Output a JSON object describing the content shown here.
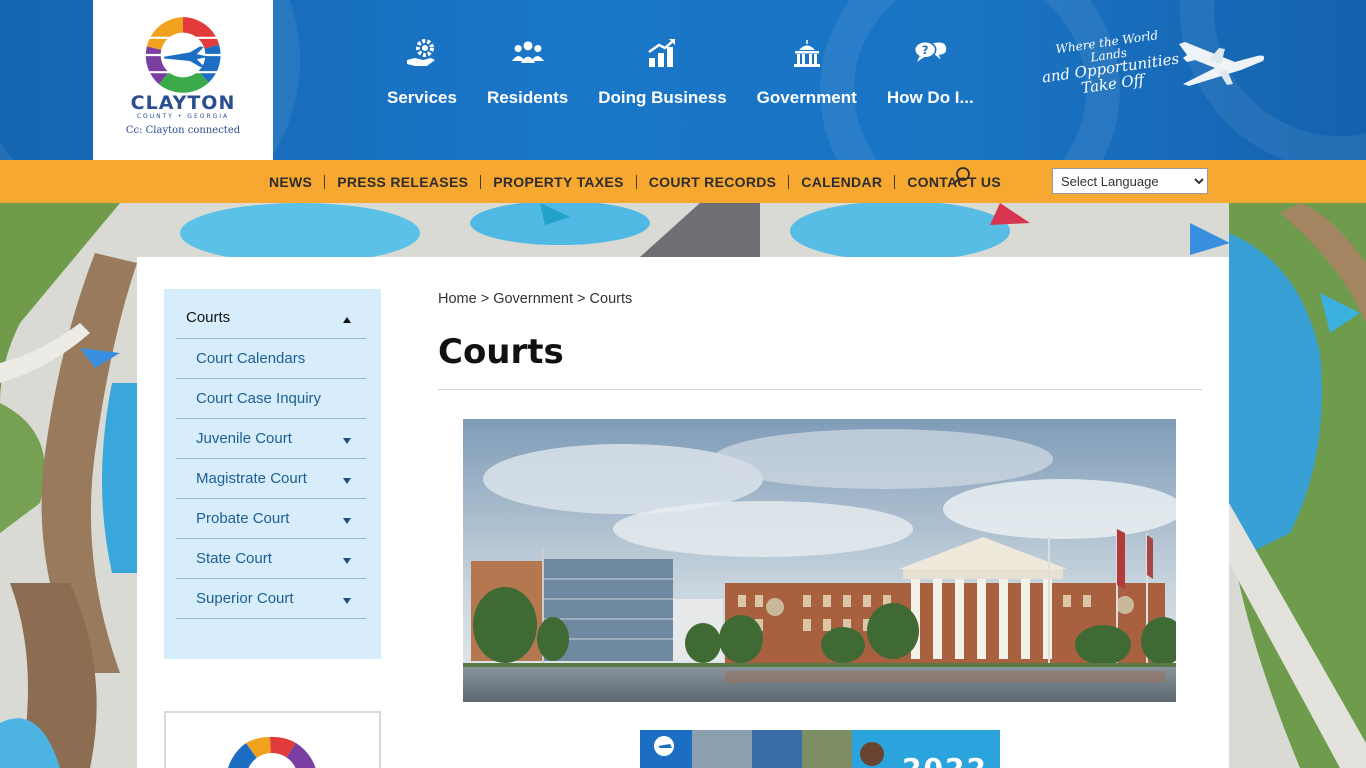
{
  "header": {
    "logo": {
      "name": "CLAYTON",
      "sub": "COUNTY • GEORGIA",
      "tagline": "Cc: Clayton connected"
    },
    "nav": [
      {
        "label": "Services",
        "icon": "hand-gear-icon"
      },
      {
        "label": "Residents",
        "icon": "people-icon"
      },
      {
        "label": "Doing Business",
        "icon": "bar-chart-icon"
      },
      {
        "label": "Government",
        "icon": "capitol-building-icon"
      },
      {
        "label": "How Do I...",
        "icon": "question-chat-icon"
      }
    ],
    "slogan": {
      "line1": "Where the World Lands",
      "line2": "and Opportunities",
      "line3": "Take Off"
    }
  },
  "utility": {
    "links": [
      "NEWS",
      "PRESS RELEASES",
      "PROPERTY TAXES",
      "COURT RECORDS",
      "CALENDAR",
      "CONTACT US"
    ],
    "language": {
      "selected": "Select Language"
    }
  },
  "sidebar": {
    "heading": "Courts",
    "items": [
      {
        "label": "Court Calendars",
        "expandable": false
      },
      {
        "label": "Court Case Inquiry",
        "expandable": false
      },
      {
        "label": "Juvenile Court",
        "expandable": true
      },
      {
        "label": "Magistrate Court",
        "expandable": true
      },
      {
        "label": "Probate Court",
        "expandable": true
      },
      {
        "label": "State Court",
        "expandable": true
      },
      {
        "label": "Superior Court",
        "expandable": true
      }
    ]
  },
  "main": {
    "breadcrumb": [
      "Home",
      "Government",
      "Courts"
    ],
    "breadcrumb_sep": ">",
    "title": "Courts",
    "promo_year": "2022"
  },
  "colors": {
    "header_blue": "#1a74c4",
    "utility_orange": "#f6a831",
    "sidebar_bg": "#d7edfb",
    "link_blue": "#1d5f93"
  }
}
